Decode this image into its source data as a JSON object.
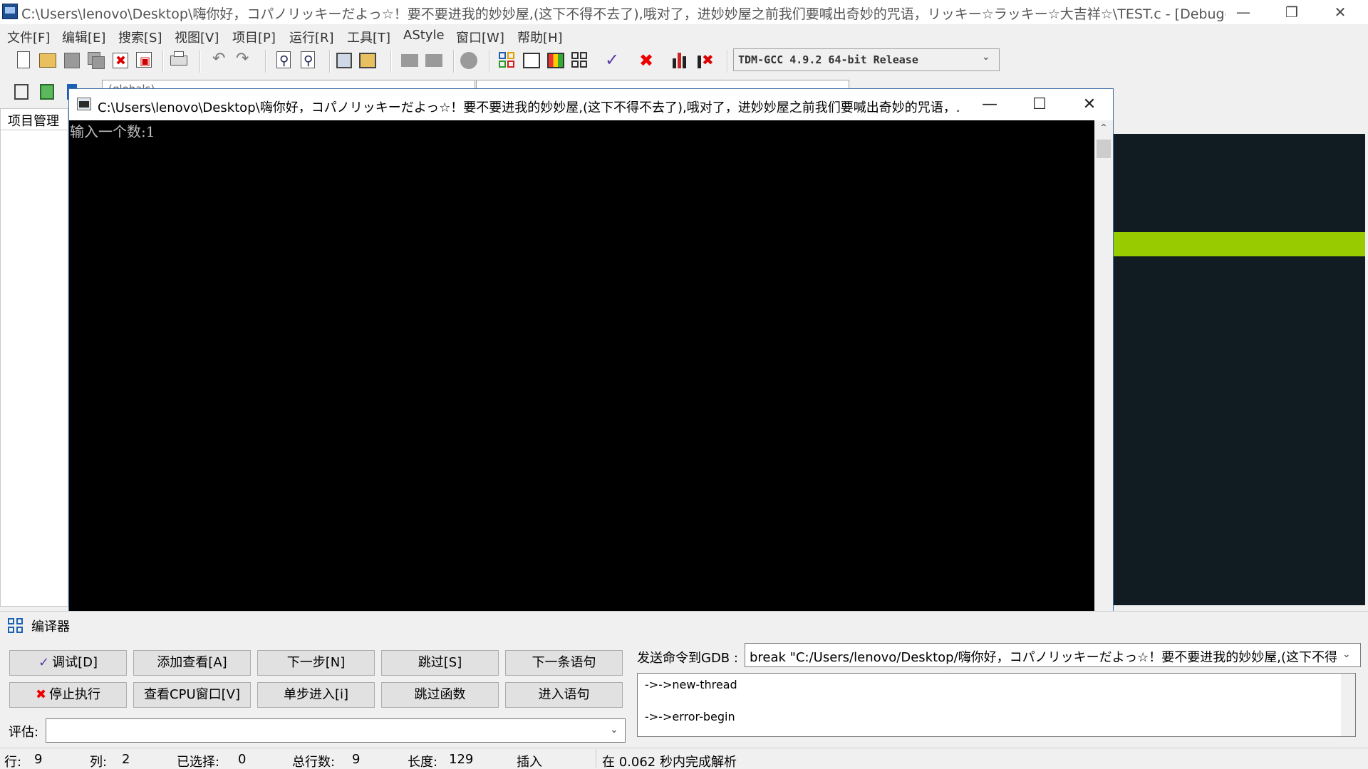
{
  "main_window": {
    "title": "C:\\Users\\lenovo\\Desktop\\嗨你好，コパノリッキーだよっ☆！要不要进我的妙妙屋,(这下不得不去了),哦对了，进妙妙屋之前我们要喊出奇妙的咒语，リッキー☆ラッキー☆大吉祥☆\\TEST.c - [Debugging] - De..."
  },
  "menu": [
    "文件[F]",
    "编辑[E]",
    "搜索[S]",
    "视图[V]",
    "项目[P]",
    "运行[R]",
    "工具[T]",
    "AStyle",
    "窗口[W]",
    "帮助[H]"
  ],
  "toolbar": {
    "compiler": "TDM-GCC 4.9.2 64-bit Release",
    "combo_left": "(globals)"
  },
  "project_tab": "项目管理",
  "console": {
    "title": "C:\\Users\\lenovo\\Desktop\\嗨你好，コパノリッキーだよっ☆！要不要进我的妙妙屋,(这下不得不去了),哦对了，进妙妙屋之前我们要喊出奇妙的咒语，...",
    "output": "输入一个数:1"
  },
  "bottom_tab": "编译器",
  "debug": {
    "row1": [
      "调试[D]",
      "添加查看[A]",
      "下一步[N]",
      "跳过[S]",
      "下一条语句"
    ],
    "row2": [
      "停止执行",
      "查看CPU窗口[V]",
      "单步进入[i]",
      "跳过函数",
      "进入语句"
    ],
    "gdb_label": "发送命令到GDB :",
    "gdb_command": "break \"C:/Users/lenovo/Desktop/嗨你好，コパノリッキーだよっ☆！要不要进我的妙妙屋,(这下不得",
    "gdb_output": [
      "->->new-thread",
      "->->error-begin"
    ],
    "eval_label": "评估:"
  },
  "status": {
    "row_label": "行:",
    "row_value": "9",
    "col_label": "列:",
    "col_value": "2",
    "sel_label": "已选择:",
    "sel_value": "0",
    "lines_label": "总行数:",
    "lines_value": "9",
    "len_label": "长度:",
    "len_value": "129",
    "mode": "插入",
    "parse": "在 0.062 秒内完成解析"
  },
  "colors": {
    "editor_bg": "#101b22",
    "editor_highlight": "#99cc00",
    "console_bg": "#000000",
    "console_text": "#c0c0c0"
  }
}
